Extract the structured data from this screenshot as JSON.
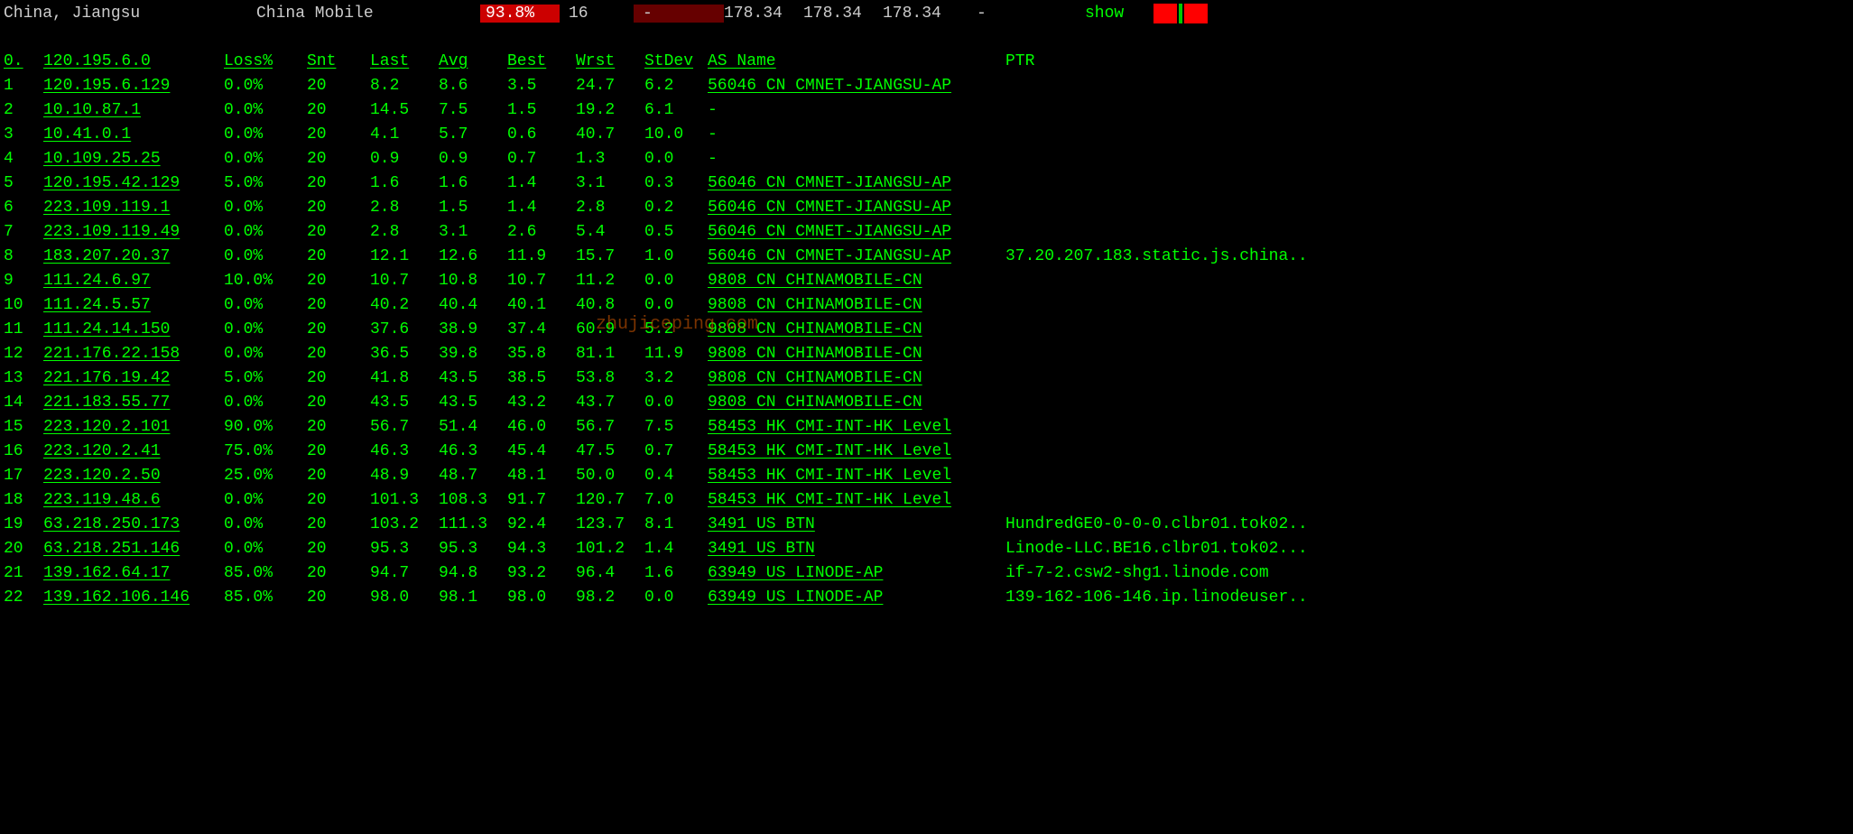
{
  "header": {
    "location": "China, Jiangsu",
    "isp": "China Mobile",
    "loss": "93.8%",
    "snt": "16",
    "last": "-",
    "avg": "178.34",
    "best": "178.34",
    "wrst": "178.34",
    "stdev": "-",
    "show": "show"
  },
  "cols": {
    "hop": "0.",
    "ip": "120.195.6.0",
    "loss": "Loss%",
    "snt": "Snt",
    "last": "Last",
    "avg": "Avg",
    "best": "Best",
    "wrst": "Wrst",
    "stdev": "StDev",
    "as": "AS Name",
    "ptr": "PTR"
  },
  "hops": [
    {
      "n": "1",
      "ip": "120.195.6.129",
      "loss": "0.0%",
      "snt": "20",
      "last": "8.2",
      "avg": "8.6",
      "best": "3.5",
      "wrst": "24.7",
      "stdev": "6.2",
      "as": "56046 CN CMNET-JIANGSU-AP",
      "ptr": ""
    },
    {
      "n": "2",
      "ip": "10.10.87.1",
      "loss": "0.0%",
      "snt": "20",
      "last": "14.5",
      "avg": "7.5",
      "best": "1.5",
      "wrst": "19.2",
      "stdev": "6.1",
      "as": "-",
      "ptr": ""
    },
    {
      "n": "3",
      "ip": "10.41.0.1",
      "loss": "0.0%",
      "snt": "20",
      "last": "4.1",
      "avg": "5.7",
      "best": "0.6",
      "wrst": "40.7",
      "stdev": "10.0",
      "as": "-",
      "ptr": ""
    },
    {
      "n": "4",
      "ip": "10.109.25.25",
      "loss": "0.0%",
      "snt": "20",
      "last": "0.9",
      "avg": "0.9",
      "best": "0.7",
      "wrst": "1.3",
      "stdev": "0.0",
      "as": "-",
      "ptr": ""
    },
    {
      "n": "5",
      "ip": "120.195.42.129",
      "loss": "5.0%",
      "snt": "20",
      "last": "1.6",
      "avg": "1.6",
      "best": "1.4",
      "wrst": "3.1",
      "stdev": "0.3",
      "as": "56046 CN CMNET-JIANGSU-AP",
      "ptr": ""
    },
    {
      "n": "6",
      "ip": "223.109.119.1",
      "loss": "0.0%",
      "snt": "20",
      "last": "2.8",
      "avg": "1.5",
      "best": "1.4",
      "wrst": "2.8",
      "stdev": "0.2",
      "as": "56046 CN CMNET-JIANGSU-AP",
      "ptr": ""
    },
    {
      "n": "7",
      "ip": "223.109.119.49",
      "loss": "0.0%",
      "snt": "20",
      "last": "2.8",
      "avg": "3.1",
      "best": "2.6",
      "wrst": "5.4",
      "stdev": "0.5",
      "as": "56046 CN CMNET-JIANGSU-AP",
      "ptr": ""
    },
    {
      "n": "8",
      "ip": "183.207.20.37",
      "loss": "0.0%",
      "snt": "20",
      "last": "12.1",
      "avg": "12.6",
      "best": "11.9",
      "wrst": "15.7",
      "stdev": "1.0",
      "as": "56046 CN CMNET-JIANGSU-AP",
      "ptr": "37.20.207.183.static.js.china.."
    },
    {
      "n": "9",
      "ip": "111.24.6.97",
      "loss": "10.0%",
      "snt": "20",
      "last": "10.7",
      "avg": "10.8",
      "best": "10.7",
      "wrst": "11.2",
      "stdev": "0.0",
      "as": "9808  CN CHINAMOBILE-CN",
      "ptr": ""
    },
    {
      "n": "10",
      "ip": "111.24.5.57",
      "loss": "0.0%",
      "snt": "20",
      "last": "40.2",
      "avg": "40.4",
      "best": "40.1",
      "wrst": "40.8",
      "stdev": "0.0",
      "as": "9808  CN CHINAMOBILE-CN",
      "ptr": ""
    },
    {
      "n": "11",
      "ip": "111.24.14.150",
      "loss": "0.0%",
      "snt": "20",
      "last": "37.6",
      "avg": "38.9",
      "best": "37.4",
      "wrst": "60.9",
      "stdev": "5.2",
      "as": "9808  CN CHINAMOBILE-CN",
      "ptr": ""
    },
    {
      "n": "12",
      "ip": "221.176.22.158",
      "loss": "0.0%",
      "snt": "20",
      "last": "36.5",
      "avg": "39.8",
      "best": "35.8",
      "wrst": "81.1",
      "stdev": "11.9",
      "as": "9808  CN CHINAMOBILE-CN",
      "ptr": ""
    },
    {
      "n": "13",
      "ip": "221.176.19.42",
      "loss": "5.0%",
      "snt": "20",
      "last": "41.8",
      "avg": "43.5",
      "best": "38.5",
      "wrst": "53.8",
      "stdev": "3.2",
      "as": "9808  CN CHINAMOBILE-CN",
      "ptr": ""
    },
    {
      "n": "14",
      "ip": "221.183.55.77",
      "loss": "0.0%",
      "snt": "20",
      "last": "43.5",
      "avg": "43.5",
      "best": "43.2",
      "wrst": "43.7",
      "stdev": "0.0",
      "as": "9808  CN CHINAMOBILE-CN",
      "ptr": ""
    },
    {
      "n": "15",
      "ip": "223.120.2.101",
      "loss": "90.0%",
      "snt": "20",
      "last": "56.7",
      "avg": "51.4",
      "best": "46.0",
      "wrst": "56.7",
      "stdev": "7.5",
      "as": "58453 HK CMI-INT-HK Level",
      "ptr": ""
    },
    {
      "n": "16",
      "ip": "223.120.2.41",
      "loss": "75.0%",
      "snt": "20",
      "last": "46.3",
      "avg": "46.3",
      "best": "45.4",
      "wrst": "47.5",
      "stdev": "0.7",
      "as": "58453 HK CMI-INT-HK Level",
      "ptr": ""
    },
    {
      "n": "17",
      "ip": "223.120.2.50",
      "loss": "25.0%",
      "snt": "20",
      "last": "48.9",
      "avg": "48.7",
      "best": "48.1",
      "wrst": "50.0",
      "stdev": "0.4",
      "as": "58453 HK CMI-INT-HK Level",
      "ptr": ""
    },
    {
      "n": "18",
      "ip": "223.119.48.6",
      "loss": "0.0%",
      "snt": "20",
      "last": "101.3",
      "avg": "108.3",
      "best": "91.7",
      "wrst": "120.7",
      "stdev": "7.0",
      "as": "58453 HK CMI-INT-HK Level",
      "ptr": ""
    },
    {
      "n": "19",
      "ip": "63.218.250.173",
      "loss": "0.0%",
      "snt": "20",
      "last": "103.2",
      "avg": "111.3",
      "best": "92.4",
      "wrst": "123.7",
      "stdev": "8.1",
      "as": "3491  US BTN",
      "ptr": "HundredGE0-0-0-0.clbr01.tok02.."
    },
    {
      "n": "20",
      "ip": "63.218.251.146",
      "loss": "0.0%",
      "snt": "20",
      "last": "95.3",
      "avg": "95.3",
      "best": "94.3",
      "wrst": "101.2",
      "stdev": "1.4",
      "as": "3491  US BTN",
      "ptr": "Linode-LLC.BE16.clbr01.tok02..."
    },
    {
      "n": "21",
      "ip": "139.162.64.17",
      "loss": "85.0%",
      "snt": "20",
      "last": "94.7",
      "avg": "94.8",
      "best": "93.2",
      "wrst": "96.4",
      "stdev": "1.6",
      "as": "63949 US LINODE-AP",
      "ptr": "if-7-2.csw2-shg1.linode.com"
    },
    {
      "n": "22",
      "ip": "139.162.106.146",
      "loss": "85.0%",
      "snt": "20",
      "last": "98.0",
      "avg": "98.1",
      "best": "98.0",
      "wrst": "98.2",
      "stdev": "0.0",
      "as": "63949 US LINODE-AP",
      "ptr": "139-162-106-146.ip.linodeuser.."
    }
  ],
  "watermark": "zhujiceping.com"
}
